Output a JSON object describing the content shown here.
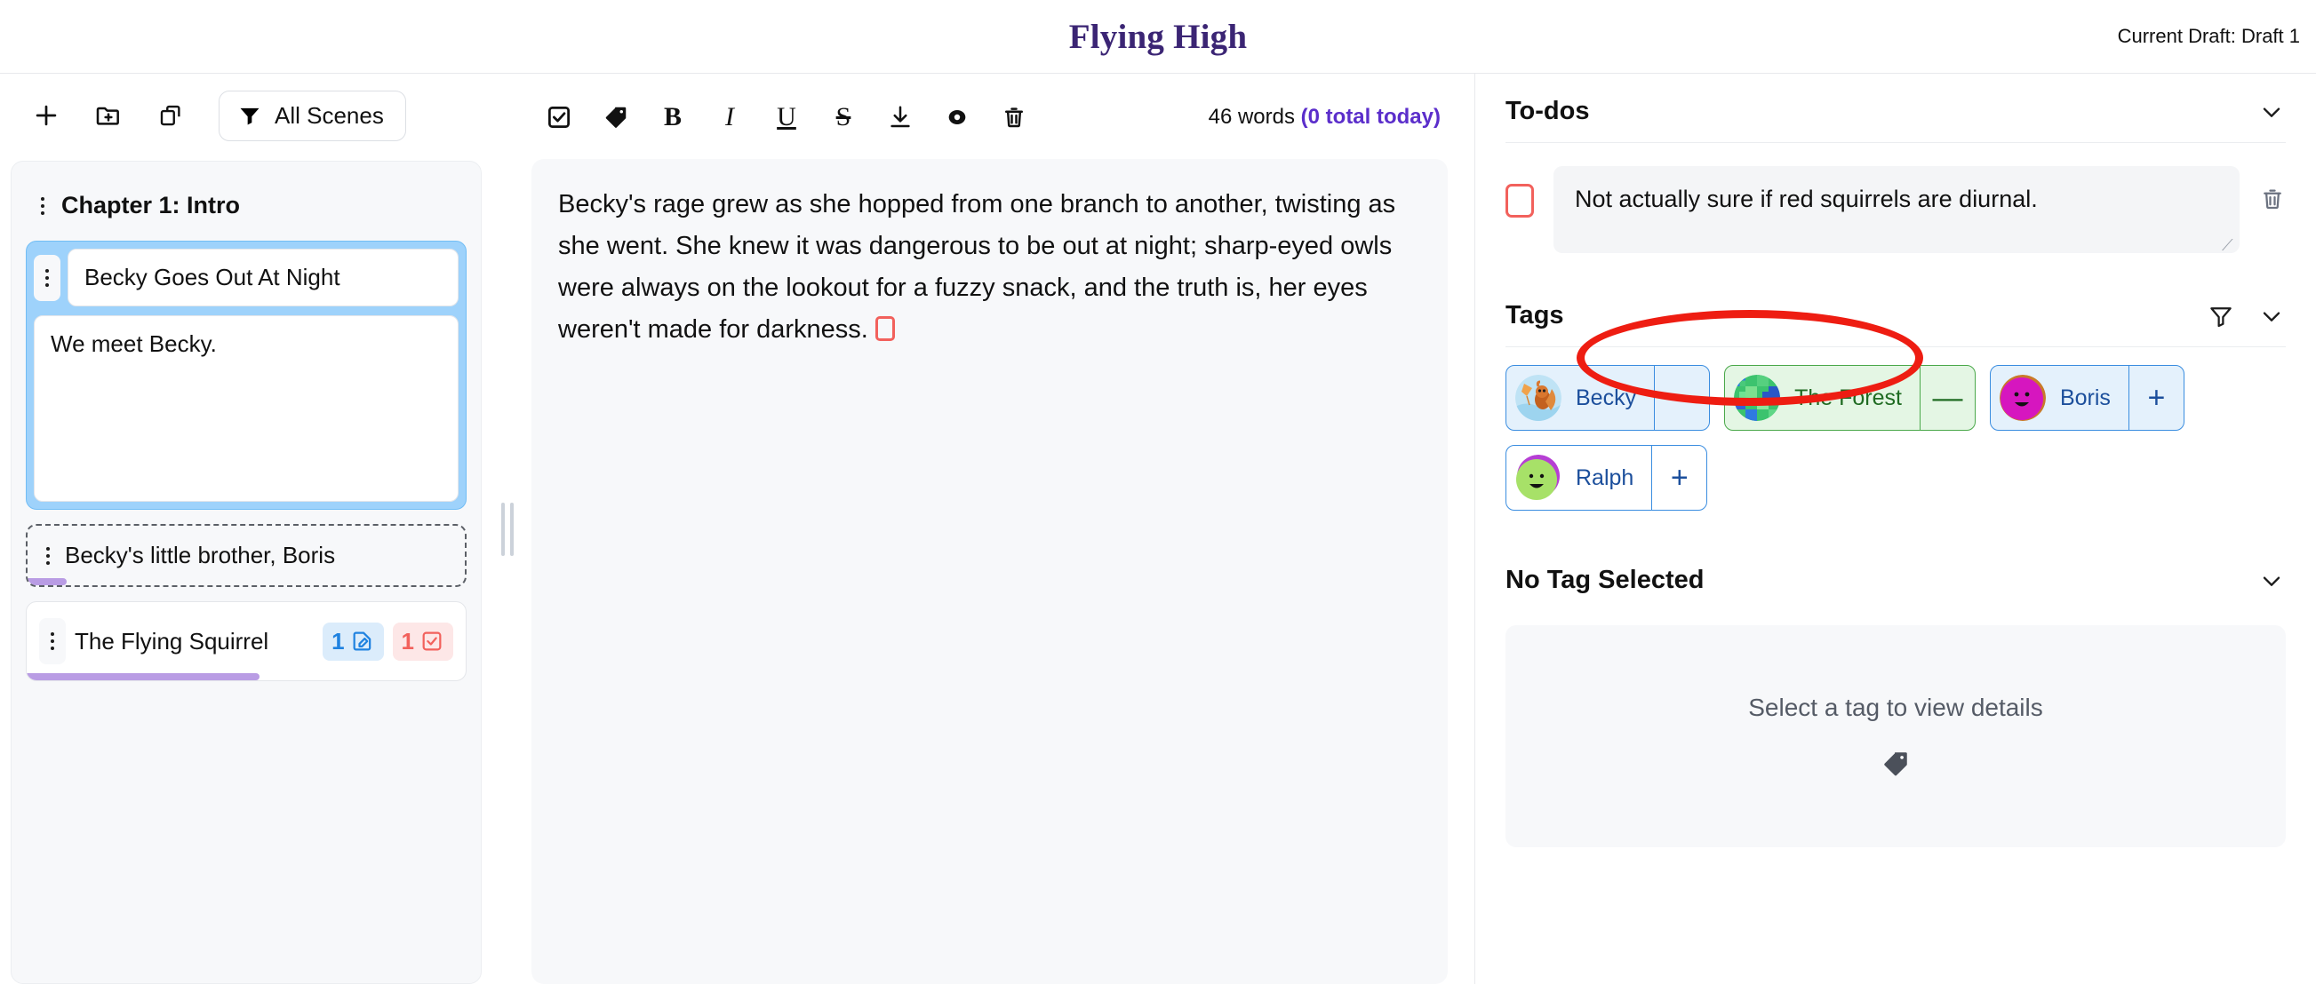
{
  "header": {
    "book_title": "Flying High",
    "draft_label": "Current Draft: Draft 1"
  },
  "sidebar": {
    "toolbar": [
      {
        "name": "add-scene-button",
        "icon": "plus-icon",
        "label": ""
      },
      {
        "name": "add-folder-button",
        "icon": "folder-plus-icon",
        "label": ""
      },
      {
        "name": "duplicate-button",
        "icon": "copy-icon",
        "label": ""
      }
    ],
    "filter": {
      "icon": "funnel-icon",
      "label": "All Scenes"
    },
    "chapter": {
      "title": "Chapter 1: Intro"
    },
    "scenes": [
      {
        "title": "Becky Goes Out At Night",
        "summary": "We meet Becky.",
        "selected": true,
        "dashed": false,
        "progress_pct": 0,
        "note_count": "",
        "todo_count": ""
      },
      {
        "title": "Becky's little brother, Boris",
        "summary": "",
        "selected": false,
        "dashed": true,
        "progress_pct": 9,
        "note_count": "",
        "todo_count": ""
      },
      {
        "title": "The Flying Squirrel",
        "summary": "",
        "selected": false,
        "dashed": false,
        "progress_pct": 53,
        "note_count": "1",
        "todo_count": "1"
      }
    ]
  },
  "editor": {
    "toolbar": [
      {
        "name": "insert-todo-button",
        "icon": "checkbox-icon",
        "label": ""
      },
      {
        "name": "insert-tag-button",
        "icon": "tag-icon",
        "label": ""
      },
      {
        "name": "bold-button",
        "icon": "bold-icon",
        "label": "B"
      },
      {
        "name": "italic-button",
        "icon": "italic-icon",
        "label": "I"
      },
      {
        "name": "underline-button",
        "icon": "underline-icon",
        "label": "U"
      },
      {
        "name": "strikethrough-button",
        "icon": "strikethrough-icon",
        "label": "S"
      },
      {
        "name": "download-button",
        "icon": "download-icon",
        "label": ""
      },
      {
        "name": "preview-button",
        "icon": "eye-icon",
        "label": ""
      },
      {
        "name": "delete-button",
        "icon": "trash-icon",
        "label": ""
      }
    ],
    "word_count": "46 words ",
    "word_count_today": "(0 total today)",
    "body_text": "Becky's rage grew as she hopped from one branch to another, twisting as she went. She knew it was dangerous to be out at night; sharp-eyed owls were always on the lookout for a fuzzy snack, and the truth is, her eyes weren't made for darkness."
  },
  "right_panel": {
    "todos": {
      "title": "To-dos",
      "items": [
        {
          "text": "Not actually sure if red squirrels are diurnal.",
          "checked": false
        }
      ]
    },
    "tags": {
      "title": "Tags",
      "items": [
        {
          "name": "Becky",
          "avatar": "squirrel-kite-avatar",
          "state": "added",
          "action": "−",
          "style": "filled"
        },
        {
          "name": "The Forest",
          "avatar": "forest-mosaic-avatar",
          "state": "active",
          "action": "—",
          "style": "green"
        },
        {
          "name": "Boris",
          "avatar": "magenta-face-avatar",
          "state": "available",
          "action": "+",
          "style": "filled"
        },
        {
          "name": "Ralph",
          "avatar": "green-face-avatar",
          "state": "available",
          "action": "+",
          "style": "plain"
        }
      ]
    },
    "detail": {
      "title": "No Tag Selected",
      "empty_message": "Select a tag to view details",
      "empty_icon": "tag-icon"
    }
  },
  "colors": {
    "brand_purple": "#3b2574",
    "accent_purple": "#5b2ecb",
    "selection_blue": "#9ed2fb",
    "todo_red": "#f2615c",
    "tag_blue": "#3a8de0",
    "tag_green": "#4aa84a",
    "annotation_red": "#ee1d12",
    "progress_purple": "#b99ce4"
  }
}
